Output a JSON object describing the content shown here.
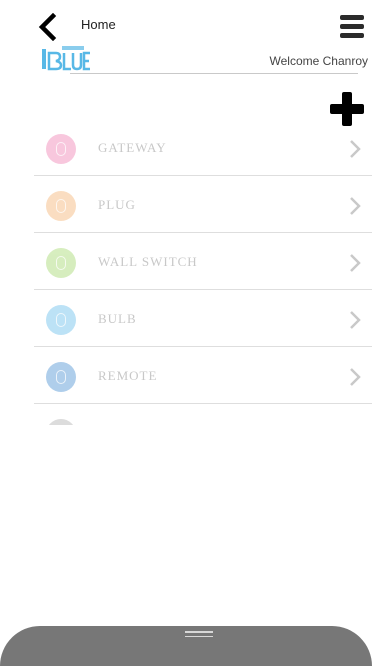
{
  "header": {
    "title": "Home",
    "welcome": "Welcome Chanroy",
    "back_icon": "back-arrow-icon",
    "menu_icon": "hamburger-menu-icon",
    "add_icon": "plus-icon",
    "logo_icon": "brand-logo-icon"
  },
  "devices": [
    {
      "label": "GATEWAY",
      "icon": "gateway-icon",
      "color": "#f39ac3"
    },
    {
      "label": "PLUG",
      "icon": "plug-icon",
      "color": "#f7c38f"
    },
    {
      "label": "WALL SWITCH",
      "icon": "wall-switch-icon",
      "color": "#b6e08a"
    },
    {
      "label": "BULB",
      "icon": "bulb-icon",
      "color": "#87cbef"
    },
    {
      "label": "REMOTE",
      "icon": "remote-icon",
      "color": "#6fa7dc"
    }
  ],
  "colors": {
    "bottom_bar": "#777777",
    "logo_blue": "#58b8e6"
  }
}
